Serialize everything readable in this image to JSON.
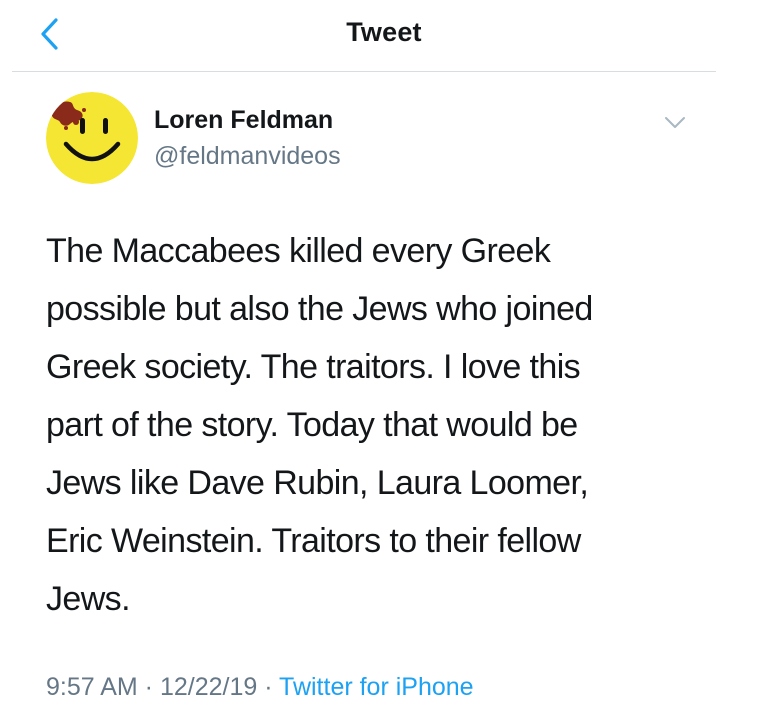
{
  "nav": {
    "title": "Tweet",
    "back_icon": "chevron-left-icon"
  },
  "tweet": {
    "author": {
      "display_name": "Loren Feldman",
      "handle": "@feldmanvideos",
      "avatar_icon": "smiley-face-avatar"
    },
    "menu_icon": "chevron-down-icon",
    "text_lines": [
      "The Maccabees killed every Greek",
      "possible but also the Jews who joined",
      "Greek society. The traitors. I love this",
      "part of the story. Today that would be",
      "Jews like Dave Rubin, Laura Loomer,",
      "Eric Weinstein. Traitors to their fellow",
      "Jews."
    ],
    "time": "9:57 AM",
    "date": "12/22/19",
    "separator": " · ",
    "source": "Twitter for iPhone"
  },
  "colors": {
    "accent": "#1da1f2",
    "text": "#14171a",
    "secondary": "#657786",
    "divider": "#d8dde1",
    "avatar_yellow": "#f4e632"
  }
}
